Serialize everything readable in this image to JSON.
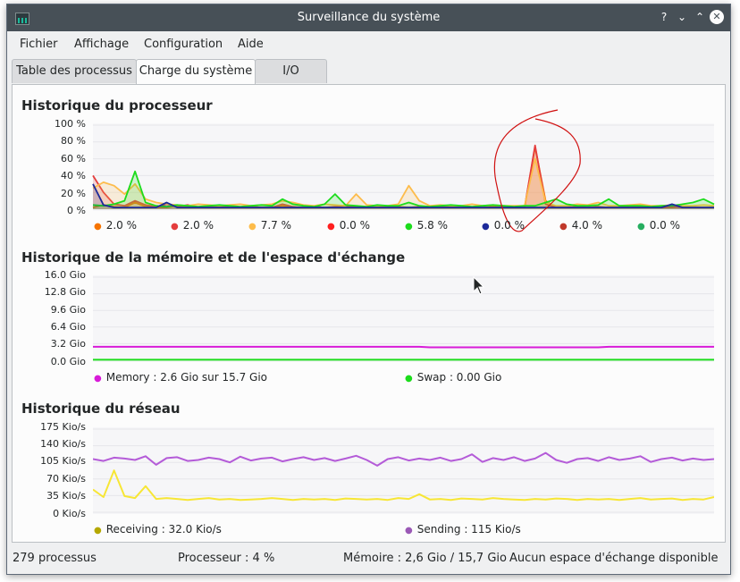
{
  "window": {
    "title": "Surveillance du système"
  },
  "titlebar_buttons": {
    "help": "?",
    "minimize": "⌄",
    "maximize": "⌃",
    "close": "✕"
  },
  "menubar": {
    "items": [
      "Fichier",
      "Affichage",
      "Configuration",
      "Aide"
    ]
  },
  "tabs": [
    "Table des processus",
    "Charge du système",
    "I/O"
  ],
  "active_tab": "Charge du système",
  "colors": {
    "accent": "#3daee9",
    "titlebar": "#475057"
  },
  "cpu": {
    "title": "Historique du processeur",
    "y_ticks": [
      "100 %",
      "80 %",
      "60 %",
      "40 %",
      "20 %",
      "0 %"
    ],
    "legend": [
      {
        "value": "2.0 %",
        "color": "#f67400"
      },
      {
        "value": "2.0 %",
        "color": "#e43d3d"
      },
      {
        "value": "7.7 %",
        "color": "#fdbc4b"
      },
      {
        "value": "0.0 %",
        "color": "#ff2020"
      },
      {
        "value": "5.8 %",
        "color": "#1cdc1c"
      },
      {
        "value": "0.0 %",
        "color": "#1d2a9a"
      },
      {
        "value": "4.0 %",
        "color": "#c0392b"
      },
      {
        "value": "0.0 %",
        "color": "#27ae60"
      }
    ]
  },
  "memory": {
    "title": "Historique de la mémoire et de l'espace d'échange",
    "y_ticks": [
      "16.0 Gio",
      "12.8 Gio",
      "9.6 Gio",
      "6.4 Gio",
      "3.2 Gio",
      "0.0 Gio"
    ],
    "legend": [
      {
        "label": "Memory : 2.6 Gio sur 15.7 Gio",
        "color": "#d81bd8"
      },
      {
        "label": "Swap : 0.00 Gio",
        "color": "#1cdc1c"
      }
    ]
  },
  "network": {
    "title": "Historique du réseau",
    "y_ticks": [
      "175 Kio/s",
      "140 Kio/s",
      "105 Kio/s",
      "70 Kio/s",
      "35 Kio/s",
      "0 Kio/s"
    ],
    "legend": [
      {
        "label": "Receiving : 32.0 Kio/s",
        "color": "#b5a800"
      },
      {
        "label": "Sending : 115 Kio/s",
        "color": "#9b59b6"
      }
    ]
  },
  "statusbar": {
    "processes": "279 processus",
    "cpu": "Processeur : 4 %",
    "memory": "Mémoire : 2,6 Gio / 15,7 Gio",
    "swap": "Aucun espace d'échange disponible"
  },
  "chart_data": [
    {
      "type": "area",
      "title": "Historique du processeur",
      "ylim": [
        0,
        100
      ],
      "y_unit": "%",
      "series": [
        {
          "color": "#f67400",
          "values": [
            2,
            5,
            3,
            2,
            8,
            3,
            2,
            2,
            4,
            3,
            2,
            2,
            3,
            2,
            2,
            3,
            2,
            2,
            4,
            2,
            2,
            3,
            2,
            2,
            5,
            3,
            2,
            2,
            2,
            3,
            2,
            2,
            2,
            3,
            2,
            2,
            2,
            2,
            3,
            2,
            2,
            2,
            74,
            10,
            2,
            2,
            3,
            2,
            2,
            2,
            4,
            2,
            3,
            2,
            2,
            2,
            3,
            2,
            2,
            2
          ]
        },
        {
          "color": "#e43d3d",
          "values": [
            40,
            20,
            6,
            4,
            10,
            5,
            3,
            6,
            3,
            5,
            2,
            3,
            2,
            4,
            2,
            3,
            2,
            2,
            6,
            3,
            2,
            3,
            2,
            3,
            4,
            2,
            2,
            2,
            3,
            2,
            2,
            3,
            2,
            2,
            3,
            2,
            2,
            2,
            2,
            3,
            2,
            2,
            76,
            6,
            2,
            3,
            2,
            2,
            3,
            2,
            2,
            2,
            3,
            2,
            2,
            3,
            2,
            2,
            2,
            2
          ]
        },
        {
          "color": "#fdbc4b",
          "values": [
            25,
            32,
            28,
            18,
            30,
            12,
            8,
            6,
            5,
            4,
            6,
            5,
            4,
            5,
            6,
            4,
            5,
            6,
            10,
            8,
            5,
            4,
            6,
            5,
            4,
            18,
            5,
            4,
            4,
            6,
            28,
            10,
            4,
            5,
            4,
            4,
            6,
            4,
            5,
            4,
            4,
            4,
            60,
            8,
            4,
            4,
            6,
            5,
            8,
            4,
            4,
            5,
            6,
            4,
            4,
            5,
            4,
            4,
            5,
            4
          ]
        },
        {
          "color": "#1cdc1c",
          "values": [
            5,
            4,
            6,
            10,
            45,
            8,
            4,
            3,
            5,
            4,
            3,
            4,
            5,
            4,
            3,
            4,
            5,
            4,
            12,
            6,
            4,
            3,
            6,
            18,
            5,
            4,
            3,
            5,
            4,
            4,
            8,
            4,
            3,
            4,
            5,
            4,
            3,
            4,
            5,
            4,
            3,
            4,
            4,
            8,
            12,
            6,
            4,
            4,
            5,
            12,
            4,
            4,
            4,
            3,
            4,
            4,
            6,
            8,
            12,
            6
          ]
        },
        {
          "color": "#1d2a9a",
          "values": [
            30,
            5,
            2,
            2,
            2,
            2,
            2,
            8,
            2,
            2,
            2,
            2,
            2,
            2,
            2,
            2,
            2,
            2,
            2,
            2,
            2,
            2,
            2,
            2,
            2,
            2,
            2,
            2,
            2,
            2,
            2,
            2,
            2,
            2,
            2,
            2,
            2,
            2,
            2,
            2,
            2,
            2,
            2,
            2,
            2,
            2,
            2,
            2,
            2,
            2,
            2,
            2,
            2,
            2,
            2,
            6,
            2,
            2,
            2,
            2
          ]
        }
      ]
    },
    {
      "type": "line",
      "title": "Historique de la mémoire et de l'espace d'échange",
      "ylim": [
        0,
        16
      ],
      "y_unit": "Gio",
      "series": [
        {
          "name": "Memory",
          "color": "#d81bd8",
          "values": [
            2.6,
            2.6,
            2.6,
            2.6,
            2.6,
            2.6,
            2.6,
            2.6,
            2.6,
            2.6,
            2.6,
            2.6,
            2.6,
            2.6,
            2.6,
            2.6,
            2.6,
            2.6,
            2.6,
            2.6,
            2.6,
            2.6,
            2.6,
            2.6,
            2.6,
            2.6,
            2.6,
            2.6,
            2.6,
            2.6,
            2.6,
            2.6,
            2.5,
            2.5,
            2.5,
            2.5,
            2.5,
            2.5,
            2.5,
            2.5,
            2.5,
            2.5,
            2.5,
            2.5,
            2.5,
            2.5,
            2.5,
            2.5,
            2.5,
            2.6,
            2.6,
            2.6,
            2.6,
            2.6,
            2.6,
            2.6,
            2.6,
            2.6,
            2.6,
            2.6
          ]
        },
        {
          "name": "Swap",
          "color": "#1cdc1c",
          "values": [
            0.1,
            0.1,
            0.1,
            0.1,
            0.1,
            0.1,
            0.1,
            0.1,
            0.1,
            0.1,
            0.1,
            0.1,
            0.1,
            0.1,
            0.1,
            0.1,
            0.1,
            0.1,
            0.1,
            0.1,
            0.1,
            0.1,
            0.1,
            0.1,
            0.1,
            0.1,
            0.1,
            0.1,
            0.1,
            0.1,
            0.1,
            0.1,
            0.1,
            0.1,
            0.1,
            0.1,
            0.1,
            0.1,
            0.1,
            0.1,
            0.1,
            0.1,
            0.1,
            0.1,
            0.1,
            0.1,
            0.1,
            0.1,
            0.1,
            0.1,
            0.1,
            0.1,
            0.1,
            0.1,
            0.1,
            0.1,
            0.1,
            0.1,
            0.1,
            0.1
          ]
        }
      ]
    },
    {
      "type": "line",
      "title": "Historique du réseau",
      "ylim": [
        0,
        175
      ],
      "y_unit": "Kio/s",
      "series": [
        {
          "name": "Receiving",
          "color": "#f7e635",
          "values": [
            48,
            32,
            88,
            34,
            30,
            55,
            28,
            30,
            28,
            26,
            28,
            30,
            27,
            28,
            26,
            27,
            28,
            30,
            28,
            26,
            28,
            27,
            28,
            26,
            29,
            28,
            27,
            28,
            26,
            30,
            28,
            38,
            27,
            28,
            26,
            29,
            28,
            27,
            30,
            28,
            27,
            26,
            28,
            27,
            29,
            28,
            26,
            28,
            27,
            28,
            26,
            28,
            30,
            27,
            28,
            29,
            26,
            28,
            27,
            32
          ]
        },
        {
          "name": "Sending",
          "color": "#b45bd8",
          "values": [
            112,
            108,
            115,
            113,
            110,
            118,
            100,
            114,
            116,
            108,
            110,
            115,
            112,
            105,
            117,
            109,
            113,
            115,
            107,
            112,
            116,
            110,
            114,
            108,
            113,
            119,
            110,
            98,
            112,
            116,
            109,
            113,
            110,
            115,
            108,
            112,
            122,
            106,
            114,
            110,
            116,
            108,
            113,
            125,
            110,
            104,
            112,
            114,
            108,
            116,
            110,
            113,
            118,
            106,
            112,
            115,
            109,
            113,
            110,
            112
          ]
        }
      ]
    }
  ]
}
